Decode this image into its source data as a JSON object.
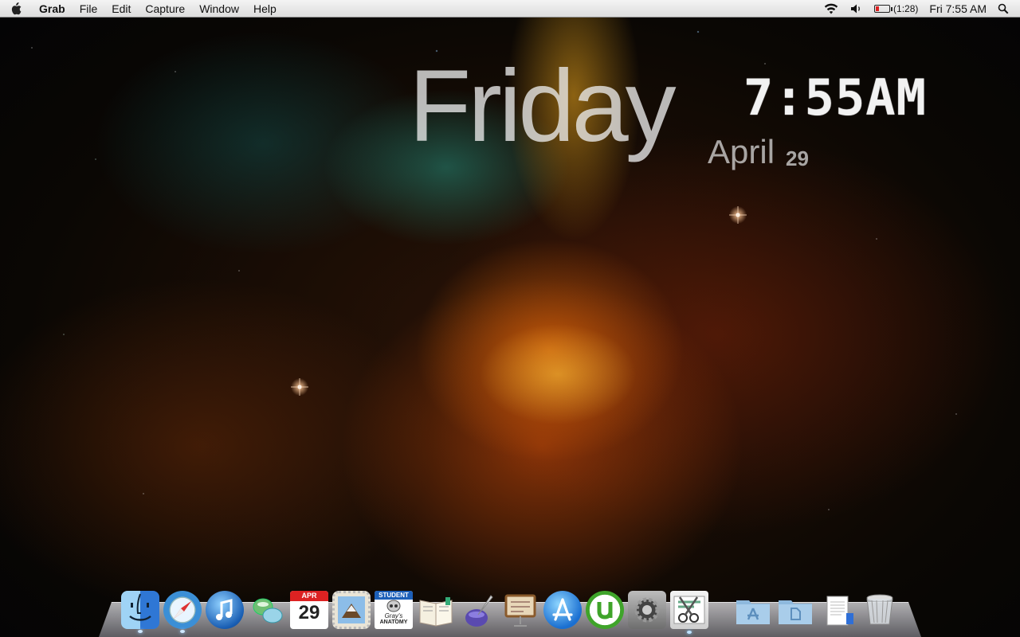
{
  "menubar": {
    "app_name": "Grab",
    "items": [
      "File",
      "Edit",
      "Capture",
      "Window",
      "Help"
    ],
    "battery_time": "(1:28)",
    "clock": "Fri 7:55 AM"
  },
  "widget": {
    "day": "Friday",
    "month": "April",
    "date": "29",
    "time": "7:55AM"
  },
  "dock": {
    "calendar": {
      "month": "APR",
      "day": "29"
    },
    "grays_anatomy": {
      "banner": "STUDENT",
      "title_line1": "Gray's",
      "title_line2": "ANATOMY"
    }
  },
  "colors": {
    "menubar_bg": "#e6e6e6",
    "battery_low": "#dd2222",
    "utorrent_green": "#3fa42a"
  }
}
